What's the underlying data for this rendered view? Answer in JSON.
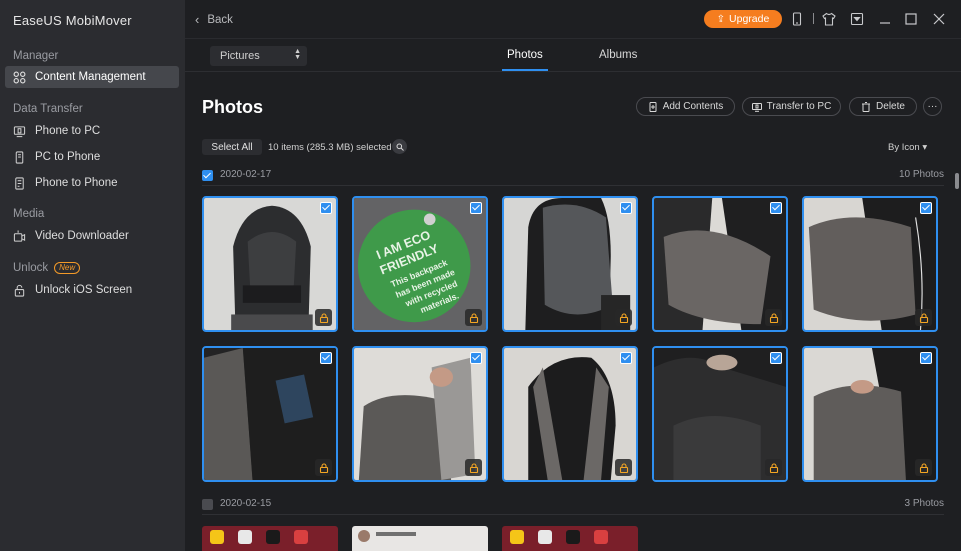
{
  "app": {
    "title": "EaseUS MobiMover"
  },
  "sidebar": {
    "sections": [
      {
        "label": "Manager"
      },
      {
        "label": "Data Transfer"
      },
      {
        "label": "Media"
      },
      {
        "label": "Unlock",
        "badge": "New"
      }
    ],
    "items": [
      {
        "label": "Content Management",
        "icon": "grid-icon",
        "active": true
      },
      {
        "label": "Phone to PC",
        "icon": "phone-to-pc-icon"
      },
      {
        "label": "PC to Phone",
        "icon": "pc-to-phone-icon"
      },
      {
        "label": "Phone to Phone",
        "icon": "phone-to-phone-icon"
      },
      {
        "label": "Video Downloader",
        "icon": "video-download-icon"
      },
      {
        "label": "Unlock iOS Screen",
        "icon": "lock-icon"
      }
    ]
  },
  "topbar": {
    "back_label": "Back",
    "upgrade_label": "Upgrade",
    "icons": [
      "device-icon",
      "shirt-icon",
      "dropdown-menu-icon",
      "minimize-icon",
      "maximize-icon",
      "close-icon"
    ]
  },
  "tabbar": {
    "category_select": "Pictures",
    "tabs": [
      {
        "label": "Photos",
        "active": true
      },
      {
        "label": "Albums"
      }
    ]
  },
  "content": {
    "title": "Photos",
    "actions": [
      {
        "label": "Add Contents",
        "icon": "add-contents-icon"
      },
      {
        "label": "Transfer to PC",
        "icon": "transfer-to-pc-icon"
      },
      {
        "label": "Delete",
        "icon": "trash-icon"
      }
    ],
    "more_label": "···",
    "select_all_label": "Select All",
    "selection_info": "10 items (285.3 MB) selected",
    "sort_label": "By Icon ▾",
    "groups": [
      {
        "date": "2020-02-17",
        "count": "10 Photos",
        "checked": true
      },
      {
        "date": "2020-02-15",
        "count": "3 Photos",
        "checked": false
      }
    ],
    "eco_tag_text": [
      "I AM ECO",
      "FRIENDLY",
      "This backpack",
      "has been made",
      "with recycled",
      "materials."
    ]
  },
  "colors": {
    "accent": "#2f8ff0",
    "upgrade": "#f57d1f",
    "lock": "#f5a623"
  }
}
